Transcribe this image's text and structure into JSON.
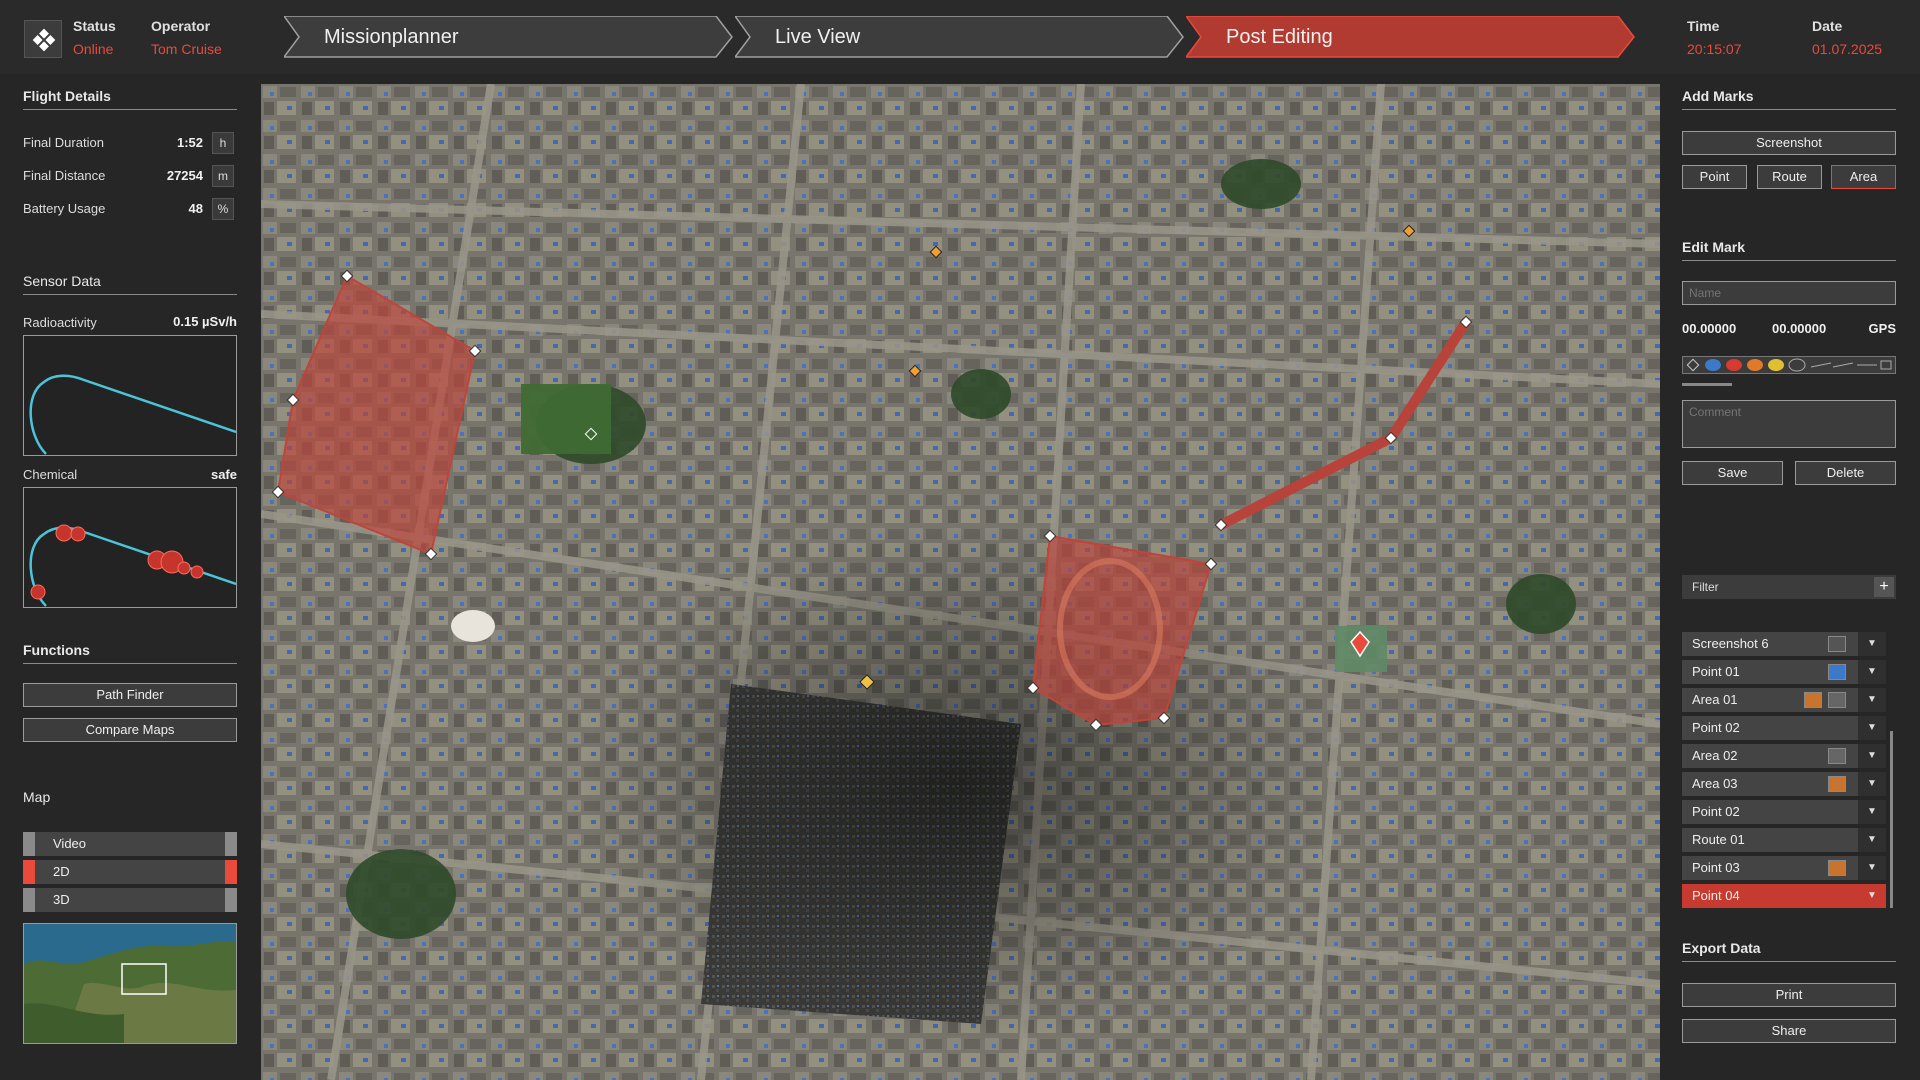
{
  "header": {
    "status_label": "Status",
    "status_value": "Online",
    "operator_label": "Operator",
    "operator_value": "Tom Cruise",
    "time_label": "Time",
    "time_value": "20:15:07",
    "date_label": "Date",
    "date_value": "01.07.2025",
    "steps": [
      {
        "label": "Missionplanner",
        "active": false
      },
      {
        "label": "Live View",
        "active": false
      },
      {
        "label": "Post Editing",
        "active": true
      }
    ]
  },
  "flight": {
    "title": "Flight Details",
    "rows": [
      {
        "label": "Final Duration",
        "value": "1:52",
        "unit": "h"
      },
      {
        "label": "Final Distance",
        "value": "27254",
        "unit": "m"
      },
      {
        "label": "Battery Usage",
        "value": "48",
        "unit": "%"
      }
    ]
  },
  "sensor": {
    "title": "Sensor Data",
    "radio_label": "Radioactivity",
    "radio_value": "0.15 µSv/h",
    "chem_label": "Chemical",
    "chem_value": "safe"
  },
  "functions": {
    "title": "Functions",
    "path_finder": "Path Finder",
    "compare_maps": "Compare Maps"
  },
  "map_modes": {
    "title": "Map",
    "items": [
      {
        "label": "Video",
        "selected": false
      },
      {
        "label": "2D",
        "selected": true
      },
      {
        "label": "3D",
        "selected": false
      }
    ]
  },
  "add_marks": {
    "title": "Add Marks",
    "screenshot": "Screenshot",
    "point": "Point",
    "route": "Route",
    "area": "Area"
  },
  "edit_mark": {
    "title": "Edit Mark",
    "name_placeholder": "Name",
    "lat": "00.00000",
    "lon": "00.00000",
    "gps": "GPS",
    "comment_placeholder": "Comment",
    "save": "Save",
    "delete": "Delete"
  },
  "filter": {
    "label": "Filter",
    "add": "+"
  },
  "marks_list": [
    {
      "label": "Screenshot 6",
      "selected": false
    },
    {
      "label": "Point 01",
      "selected": false
    },
    {
      "label": "Area 01",
      "selected": false
    },
    {
      "label": "Point 02",
      "selected": false
    },
    {
      "label": "Area 02",
      "selected": false
    },
    {
      "label": "Area 03",
      "selected": false
    },
    {
      "label": "Point 02",
      "selected": false
    },
    {
      "label": "Route 01",
      "selected": false
    },
    {
      "label": "Point 03",
      "selected": false
    },
    {
      "label": "Point 04",
      "selected": true
    }
  ],
  "export": {
    "title": "Export Data",
    "print": "Print",
    "share": "Share"
  },
  "colors": {
    "accent": "#e84a3c",
    "graph_line": "#4bc3d8",
    "area_fill": "#c0443a"
  }
}
